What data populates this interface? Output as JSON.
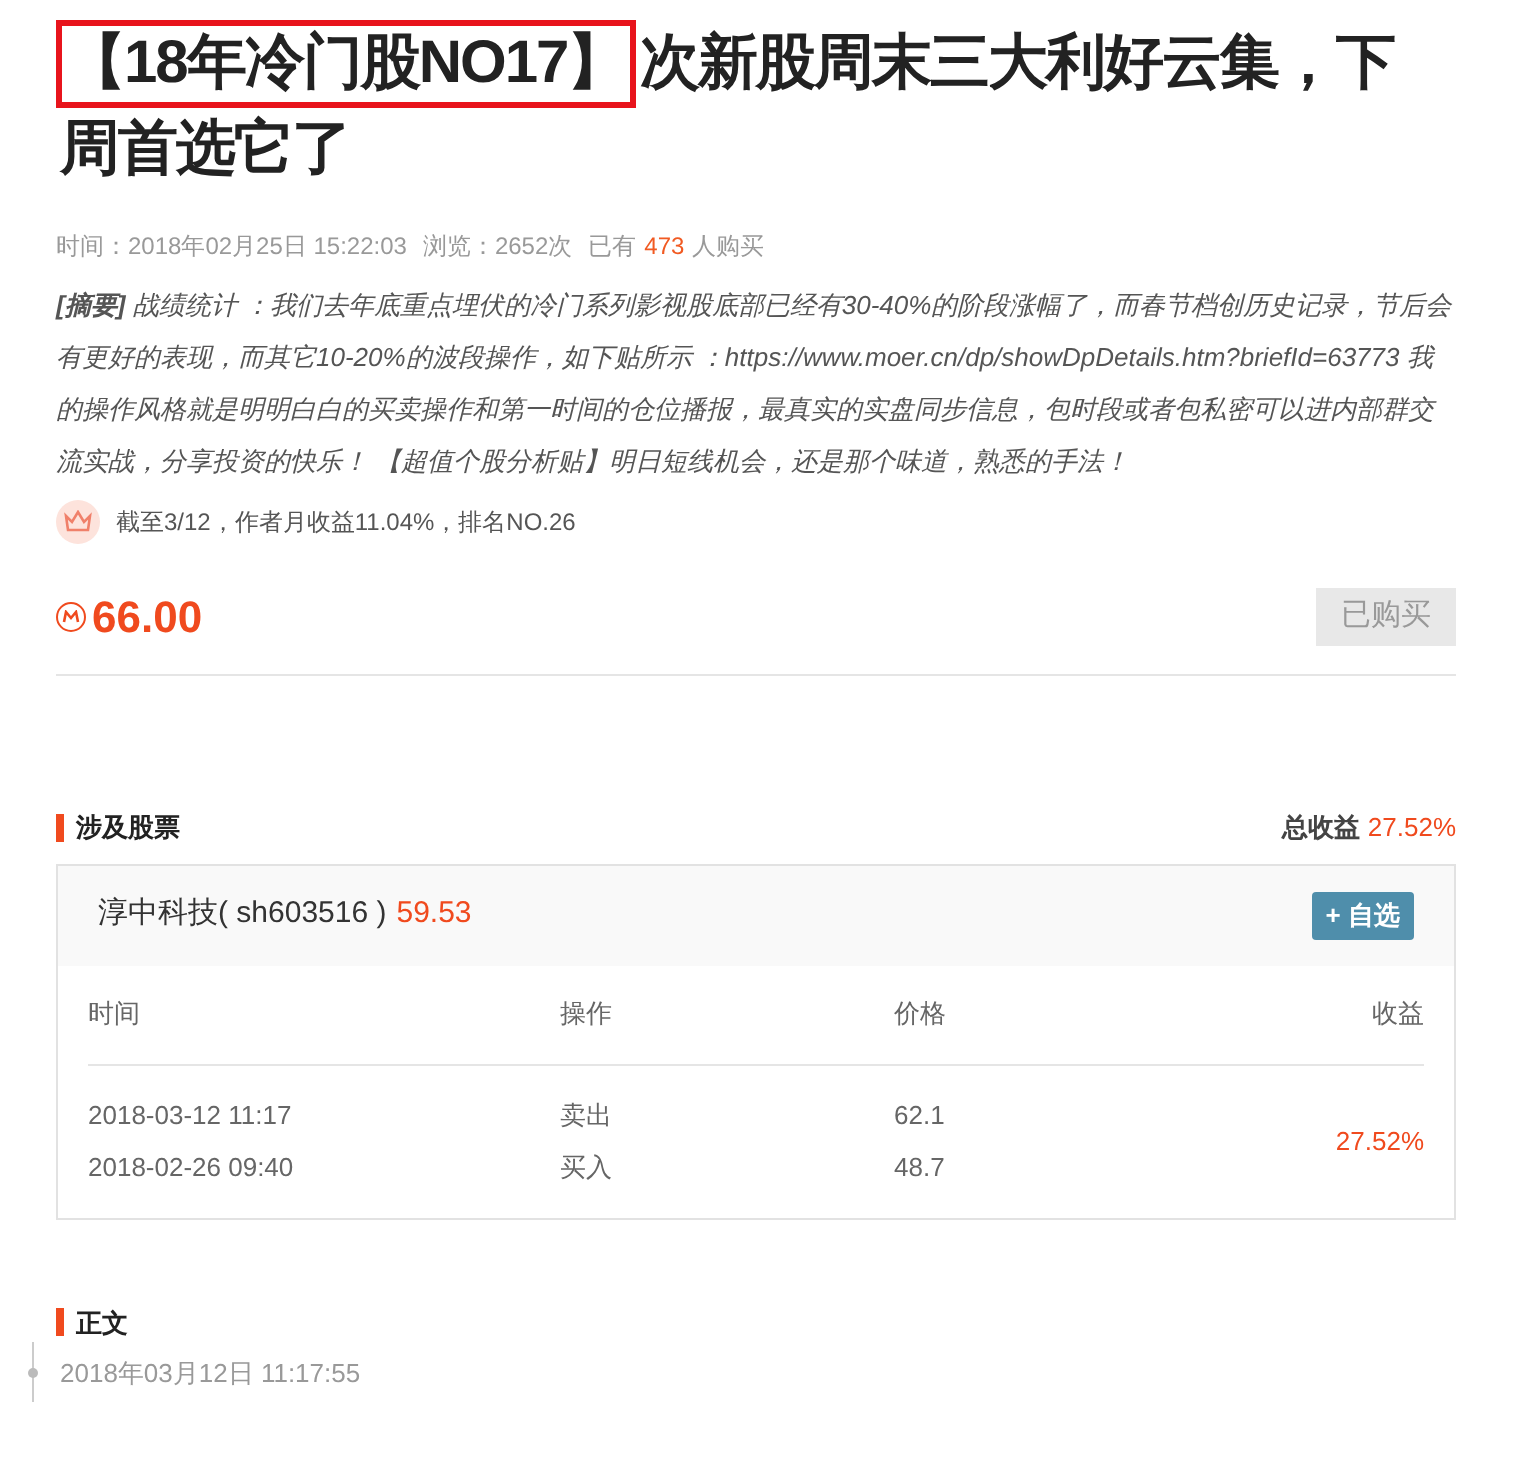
{
  "title": {
    "highlighted": "【18年冷门股NO17】",
    "lines": [
      "次新股周末三大利好云集，下",
      "周首选它了"
    ]
  },
  "meta": {
    "time": "时间：2018年02月25日 15:22:03",
    "views": "浏览：2652次",
    "bought_prefix": "已有",
    "bought_count": "473",
    "bought_suffix": "人购买"
  },
  "summary": "**[摘要]** 战绩统计 ：我们去年底重点埋伏的冷门系列影视股底部已经有30-40%的阶段涨幅了，而春节档创历史记录，节后会有更好的表现，而其它10-20%的波段操作，如下贴所示 ：https://www.moer.cn/dp/showDpDetails.htm?briefId=63773 我的操作风格就是明明白白的买卖操作和第一时间的仓位播报，最真实的实盘同步信息，包时段或者包私密可以进内部群交流实战，分享投资的快乐！ 【超值个股分析贴】明日短线机会，还是那个味道，熟悉的手法！",
  "author_rank": "截至3/12，作者月收益11.04%，排名NO.26",
  "price": "66.00",
  "buy_button": {
    "label": "已购买",
    "disabled": true
  },
  "stocks_section": {
    "heading": "涉及股票",
    "total_label": "总收益",
    "total_value": "27.52%",
    "stock": {
      "name": "淳中科技( sh603516 )",
      "price": "59.53",
      "watch_button": "+ 自选"
    },
    "columns": [
      "时间",
      "操作",
      "价格",
      "收益"
    ],
    "trades": [
      {
        "time": "2018-03-12 11:17",
        "action": "卖出",
        "price": "62.1"
      },
      {
        "time": "2018-02-26 09:40",
        "action": "买入",
        "price": "48.7"
      }
    ],
    "return": "27.52%"
  },
  "body_section": {
    "heading": "正文",
    "date": "2018年03月12日 11:17:55"
  }
}
